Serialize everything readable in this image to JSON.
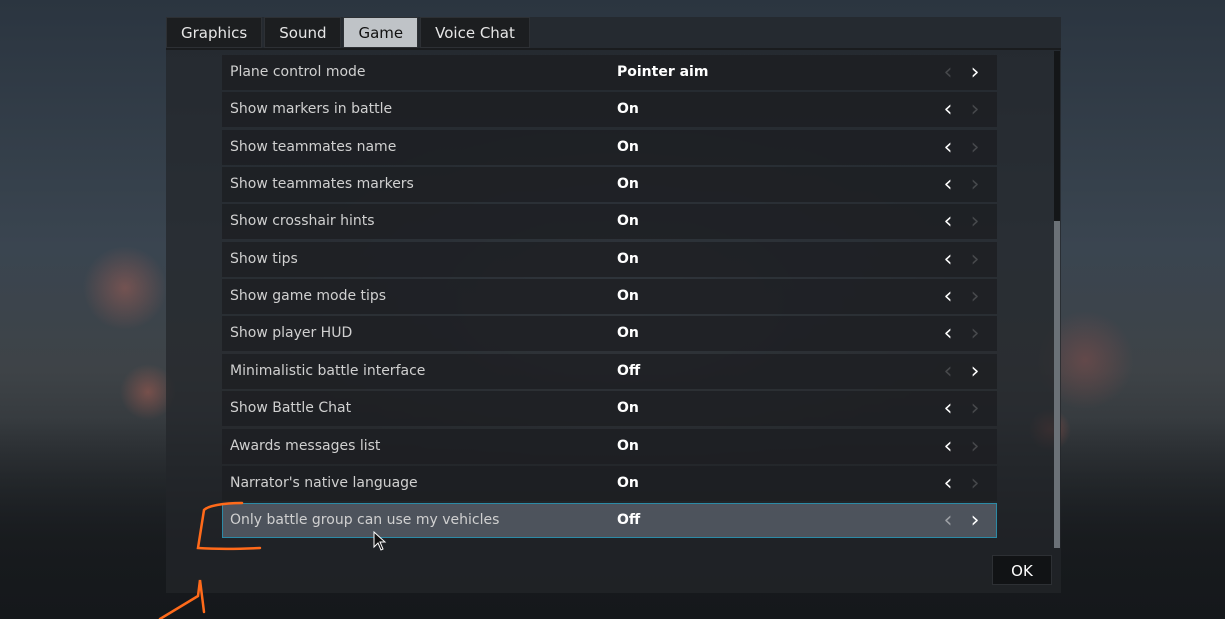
{
  "tabs": [
    {
      "label": "Graphics",
      "active": false
    },
    {
      "label": "Sound",
      "active": false
    },
    {
      "label": "Game",
      "active": true
    },
    {
      "label": "Voice Chat",
      "active": false
    }
  ],
  "settings": [
    {
      "label": "Plane control mode",
      "value": "Pointer aim",
      "left_enabled": false,
      "right_enabled": true
    },
    {
      "label": "Show markers in battle",
      "value": "On",
      "left_enabled": true,
      "right_enabled": false
    },
    {
      "label": "Show teammates name",
      "value": "On",
      "left_enabled": true,
      "right_enabled": false
    },
    {
      "label": "Show teammates markers",
      "value": "On",
      "left_enabled": true,
      "right_enabled": false
    },
    {
      "label": "Show crosshair hints",
      "value": "On",
      "left_enabled": true,
      "right_enabled": false
    },
    {
      "label": "Show tips",
      "value": "On",
      "left_enabled": true,
      "right_enabled": false
    },
    {
      "label": "Show game mode tips",
      "value": "On",
      "left_enabled": true,
      "right_enabled": false
    },
    {
      "label": "Show player HUD",
      "value": "On",
      "left_enabled": true,
      "right_enabled": false
    },
    {
      "label": "Minimalistic battle interface",
      "value": "Off",
      "left_enabled": false,
      "right_enabled": true
    },
    {
      "label": "Show Battle Chat",
      "value": "On",
      "left_enabled": true,
      "right_enabled": false
    },
    {
      "label": "Awards messages list",
      "value": "On",
      "left_enabled": true,
      "right_enabled": false
    },
    {
      "label": "Narrator's native language",
      "value": "On",
      "left_enabled": true,
      "right_enabled": false
    },
    {
      "label": "Only battle group can use my vehicles",
      "value": "Off",
      "left_enabled": false,
      "right_enabled": true,
      "selected": true
    }
  ],
  "icons": {
    "arrow_left": "‹",
    "arrow_right": "›"
  },
  "footer": {
    "ok_label": "OK"
  },
  "colors": {
    "selection_border": "#2c8aa6",
    "annotation": "#ff6a1a"
  }
}
